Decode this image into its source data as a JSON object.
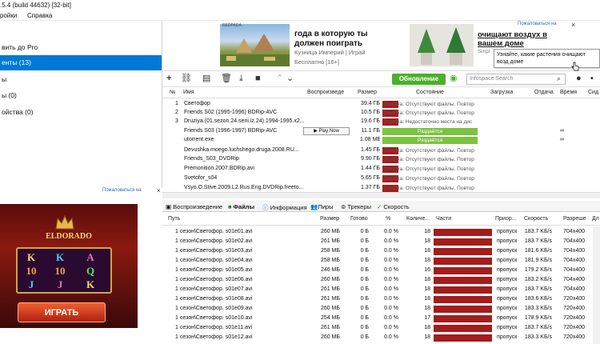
{
  "window": {
    "title": ".5.4  (build 44632) [32-bit]"
  },
  "menu": {
    "settings": "ройки",
    "help": "Справка"
  },
  "sidebar": {
    "items": [
      {
        "label": "вить до Pro"
      },
      {
        "label": "енты (13)"
      },
      {
        "label": "ы"
      },
      {
        "label": "ы (0)"
      },
      {
        "label": "ойства (0)"
      }
    ],
    "ad_link": "Пожаловаться на",
    "close": "×"
  },
  "sidebar_ad": {
    "logo": "ELDORADO",
    "reels": [
      "K",
      "K",
      "A",
      "10",
      "10",
      "Q",
      "J",
      "J",
      "K"
    ],
    "button": "ИГРАТЬ"
  },
  "top_ad": {
    "ad1": {
      "brand": "REDPADA",
      "title": "года в которую ты должен поиграть",
      "source": "Кузница Империй | Играй",
      "tag": "Бесплатно [16+]"
    },
    "ad2": {
      "link": "Пожаловаться на",
      "close": "×",
      "title": "очищают воздух в вашем доме",
      "sub": "Simpl"
    },
    "tooltip": "Узнайте, какие растения очищают возд доме"
  },
  "toolbar": {
    "update_label": "Обновление",
    "search_placeholder": "Infospace Search",
    "icons": [
      "add-icon",
      "link-icon",
      "create-icon",
      "delete-icon",
      "download-icon",
      "stop-icon",
      "up-icon",
      "down-icon"
    ]
  },
  "torrents": {
    "headers": {
      "num": "№",
      "name": "Имя",
      "play": "Воспроизведе",
      "size": "Размер",
      "state": "Состояние",
      "down": "Загрузка",
      "up": "Отдача",
      "eta": "Время",
      "seeds": "Сид"
    },
    "rows": [
      {
        "num": "1",
        "name": "Светофор",
        "play": "",
        "size": "39.4 ГБ",
        "status": "Ошибка: Отсутствуют файлы. Повтор",
        "type": "error",
        "eta": ""
      },
      {
        "num": "2",
        "name": "Friends S02 (1995-1996) BDRip-AVC",
        "play": "",
        "size": "10.5 ГБ",
        "status": "Ошибка: Отсутствуют файлы. Повтор",
        "type": "error",
        "eta": ""
      },
      {
        "num": "3",
        "name": "Druziya.(01.sezon.24.serii.iz.24).1994-1995.x2...",
        "play": "",
        "size": "19.6 ГБ",
        "status": "Ошибка: Недостаточно места на дис",
        "type": "error",
        "eta": ""
      },
      {
        "num": "",
        "name": "Friends S03 (1996-1997) BDRip-AVC",
        "play": "Play Now",
        "size": "11.1 ГБ",
        "status": "Раздаётся",
        "type": "seed",
        "eta": "∞"
      },
      {
        "num": "",
        "name": "utorrent.exe",
        "play": "",
        "size": "1.08 МБ",
        "status": "Раздаётся",
        "type": "seed",
        "eta": "∞"
      },
      {
        "num": "",
        "name": "Devushka.moego.luchshego.druga.2008.RU...",
        "play": "",
        "size": "1.45 ГБ",
        "status": "Ошибка: Отсутствуют файлы. Повтор",
        "type": "error",
        "eta": ""
      },
      {
        "num": "",
        "name": "Friends_S03_DVDRip",
        "play": "",
        "size": "9.90 ГБ",
        "status": "Ошибка: Отсутствуют файлы. Повтор",
        "type": "error",
        "eta": ""
      },
      {
        "num": "",
        "name": "Premonition.2007.BDRip.avi",
        "play": "",
        "size": "1.44 ГБ",
        "status": "Ошибка: Отсутствуют файлы. Повтор",
        "type": "error",
        "eta": ""
      },
      {
        "num": "",
        "name": "Svetofor_s04",
        "play": "",
        "size": "5.65 ГБ",
        "status": "Ошибка: Отсутствуют файлы. Повтор",
        "type": "error",
        "eta": ""
      },
      {
        "num": "",
        "name": "Vsyo.O.Stive.2009.L2.Rus.Eng.DVDRip.freeto...",
        "play": "",
        "size": "1.37 ГБ",
        "status": "Ошибка: Отсутствуют файлы. Повтор",
        "type": "error",
        "eta": ""
      }
    ]
  },
  "tabs": [
    {
      "label": "Воспроизведение"
    },
    {
      "label": "Файлы"
    },
    {
      "label": "Информация"
    },
    {
      "label": "Пиры"
    },
    {
      "label": "Трекеры"
    },
    {
      "label": "Скорость"
    }
  ],
  "files": {
    "headers": {
      "path": "Путь",
      "size": "Размер",
      "done": "Готово",
      "pct": "%",
      "pieces_n": "Количе...",
      "pieces": "Части",
      "priority": "Приор...",
      "speed": "Скорость",
      "res": "Разреше",
      "dur": "Дл"
    },
    "rows": [
      {
        "path": "1 сезон\\Светофор. s01e01.avi",
        "size": "260 МБ",
        "done": "0 Б",
        "pct": "0.0 %",
        "n": "18",
        "prio": "пропуск",
        "speed": "183.7 KБ/s",
        "res": "704x400"
      },
      {
        "path": "1 сезон\\Светофор. s01e02.avi",
        "size": "261 МБ",
        "done": "0 Б",
        "pct": "0.0 %",
        "n": "18",
        "prio": "пропуск",
        "speed": "183.7 KБ/s",
        "res": "704x400"
      },
      {
        "path": "1 сезон\\Светофор. s01e03.avi",
        "size": "258 МБ",
        "done": "0 Б",
        "pct": "0.0 %",
        "n": "18",
        "prio": "пропуск",
        "speed": "181.6 KБ/s",
        "res": "704x400"
      },
      {
        "path": "1 сезон\\Светофор. s01e04.avi",
        "size": "258 МБ",
        "done": "0 Б",
        "pct": "0.0 %",
        "n": "18",
        "prio": "пропуск",
        "speed": "181.9 KБ/s",
        "res": "704x400"
      },
      {
        "path": "1 сезон\\Светофор. s01e05.avi",
        "size": "246 МБ",
        "done": "0 Б",
        "pct": "0.0 %",
        "n": "16",
        "prio": "пропуск",
        "speed": "179.2 KБ/s",
        "res": "704x400"
      },
      {
        "path": "1 сезон\\Светофор. s01e06.avi",
        "size": "260 МБ",
        "done": "0 Б",
        "pct": "0.0 %",
        "n": "18",
        "prio": "пропуск",
        "speed": "183.2 KБ/s",
        "res": "704x400"
      },
      {
        "path": "1 сезон\\Светофор. s01e07.avi",
        "size": "261 МБ",
        "done": "0 Б",
        "pct": "0.0 %",
        "n": "18",
        "prio": "пропуск",
        "speed": "183.7 KБ/s",
        "res": "704x400"
      },
      {
        "path": "1 сезон\\Светофор. s01e08.avi",
        "size": "261 МБ",
        "done": "0 Б",
        "pct": "0.0 %",
        "n": "18",
        "prio": "пропуск",
        "speed": "183.6 KБ/s",
        "res": "720x400"
      },
      {
        "path": "1 сезон\\Светофор. s01e09.avi",
        "size": "260 МБ",
        "done": "0 Б",
        "pct": "0.0 %",
        "n": "18",
        "prio": "пропуск",
        "speed": "183.3 KБ/s",
        "res": "720x400"
      },
      {
        "path": "1 сезон\\Светофор. s01e10.avi",
        "size": "254 МБ",
        "done": "0 Б",
        "pct": "0.0 %",
        "n": "17",
        "prio": "пропуск",
        "speed": "178.9 KБ/s",
        "res": "720x400"
      },
      {
        "path": "1 сезон\\Светофор. s01e11.avi",
        "size": "261 МБ",
        "done": "0 Б",
        "pct": "0.0 %",
        "n": "18",
        "prio": "пропуск",
        "speed": "183.7 KБ/s",
        "res": "720x400"
      },
      {
        "path": "1 сезон\\Светофор. s01e12.avi",
        "size": "260 МБ",
        "done": "0 Б",
        "pct": "0.0 %",
        "n": "18",
        "prio": "пропуск",
        "speed": "183.3 KБ/s",
        "res": "720x400"
      }
    ]
  },
  "colors": {
    "selected": "#0078d7",
    "error": "#a51c1c",
    "seed": "#7dc242",
    "update": "#4caf2b",
    "link": "#2a6db5"
  }
}
